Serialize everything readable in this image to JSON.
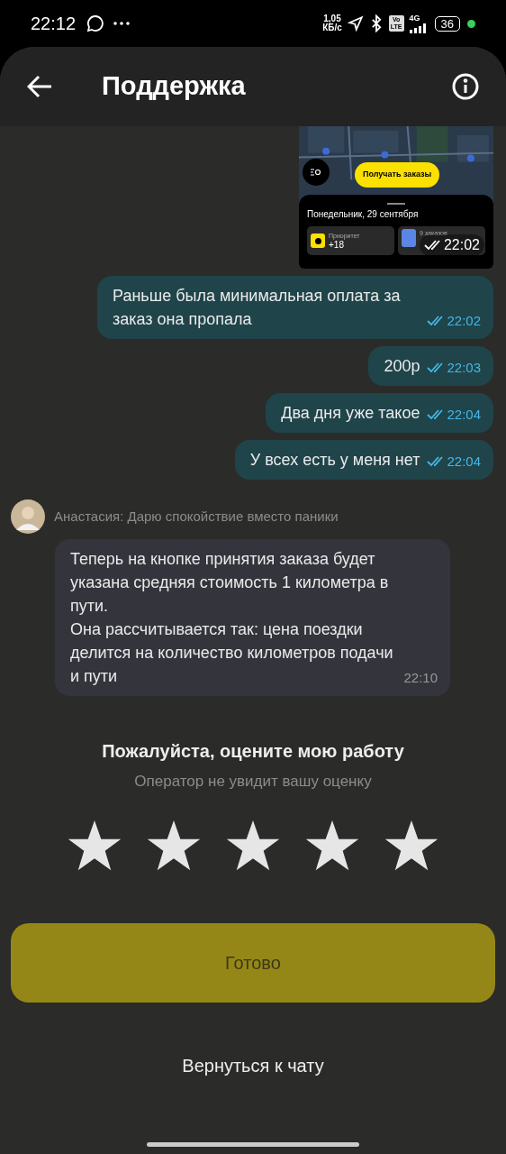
{
  "status_bar": {
    "time": "22:12",
    "speed_value": "1,05",
    "speed_unit": "КБ/с",
    "volte_top": "Vo",
    "volte_bottom": "LTE",
    "network": "4G",
    "battery": "36"
  },
  "header": {
    "title": "Поддержка"
  },
  "messages": [
    {
      "outgoing": true,
      "time": "22:02",
      "read": true,
      "app": {
        "button": "Получать заказы",
        "date": "Понедельник, 29 сентября",
        "card1_label": "Приоритет",
        "card1_value": "+18",
        "card2_label": "9 заказов"
      }
    },
    {
      "kind": "text",
      "outgoing": true,
      "text": "Раньше была минимальная оплата за заказ она пропала",
      "time": "22:02",
      "read": true
    },
    {
      "kind": "text",
      "outgoing": true,
      "text": "200р",
      "time": "22:03",
      "read": true
    },
    {
      "kind": "text",
      "outgoing": true,
      "text": "Два дня уже такое",
      "time": "22:04",
      "read": true
    },
    {
      "kind": "text",
      "outgoing": true,
      "text": "У всех есть у меня нет",
      "time": "22:04",
      "read": true
    },
    {
      "kind": "sender",
      "name": "Анастасия: Дарю спокойствие вместо паники"
    },
    {
      "kind": "text",
      "outgoing": false,
      "text": "Теперь на кнопке принятия заказа будет указана средняя стоимость 1 километра в пути.\nОна рассчитывается так: цена поездки делится на количество километров подачи и пути",
      "time": "22:10"
    }
  ],
  "rating": {
    "title": "Пожалуйста, оцените мою работу",
    "subtitle": "Оператор не увидит вашу оценку"
  },
  "done_button": {
    "label": "Готово",
    "disabled": true
  },
  "back_link": "Вернуться к чату"
}
